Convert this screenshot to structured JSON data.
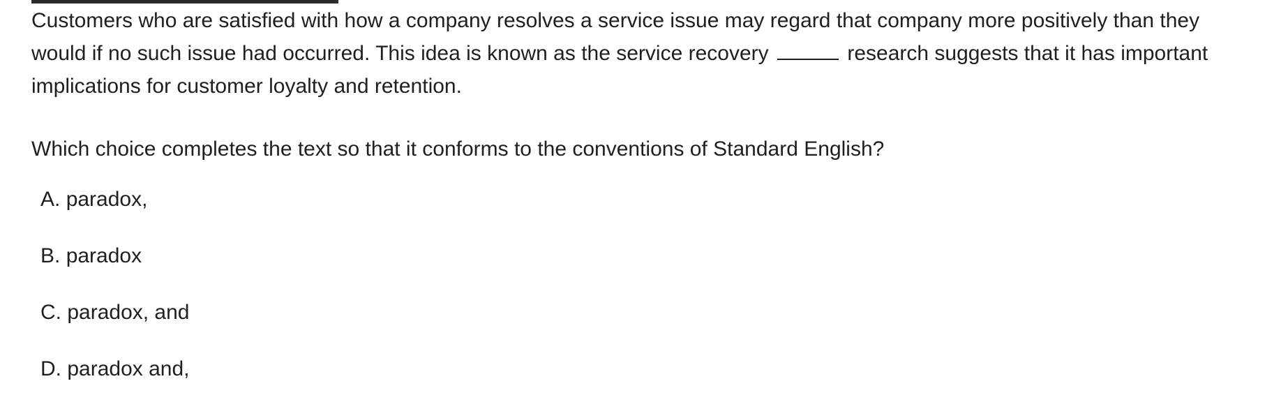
{
  "passage": {
    "before_blank": "Customers who are satisfied with how a company resolves a service issue may regard that company more positively than they would if no such issue had occurred. This idea is known as the service recovery",
    "after_blank": "research suggests that it has important implications for customer loyalty and retention."
  },
  "question": {
    "prompt": "Which choice completes the text so that it conforms to the conventions of Standard English?"
  },
  "choices": [
    {
      "letter": "A",
      "text": "paradox,"
    },
    {
      "letter": "B",
      "text": "paradox"
    },
    {
      "letter": "C",
      "text": "paradox, and"
    },
    {
      "letter": "D",
      "text": "paradox and,"
    }
  ]
}
